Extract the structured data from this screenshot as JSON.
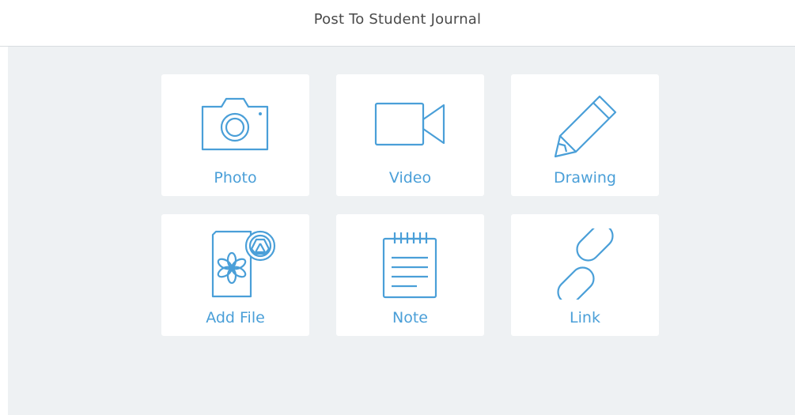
{
  "header": {
    "title": "Post To Student Journal"
  },
  "colors": {
    "accent": "#4a9fd8",
    "panel": "#eef1f3",
    "tile": "#ffffff"
  },
  "options": [
    {
      "label": "Photo",
      "icon": "camera-icon"
    },
    {
      "label": "Video",
      "icon": "video-camera-icon"
    },
    {
      "label": "Drawing",
      "icon": "pencil-icon"
    },
    {
      "label": "Add File",
      "icon": "file-drive-icon"
    },
    {
      "label": "Note",
      "icon": "notepad-icon"
    },
    {
      "label": "Link",
      "icon": "link-icon"
    }
  ]
}
